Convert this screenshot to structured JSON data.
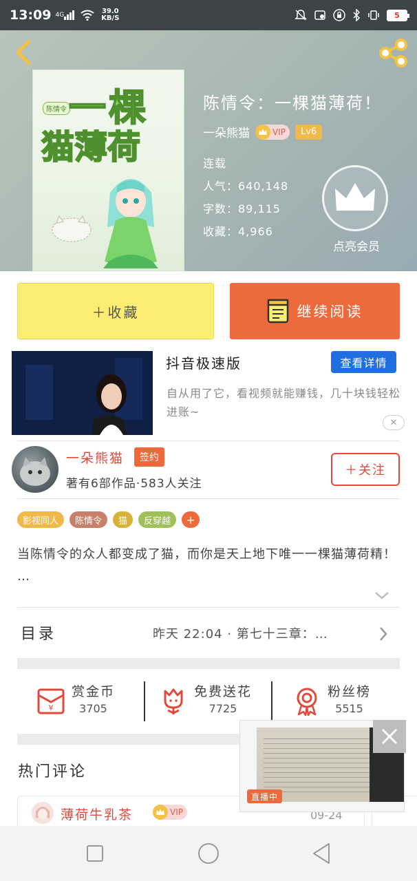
{
  "status_bar": {
    "time": "13:09",
    "network": "4G",
    "speed_value": "39.0",
    "speed_unit": "KB/S",
    "battery": "5"
  },
  "header": {
    "back_icon": "chevron-left-icon",
    "share_icon": "share-icon"
  },
  "book": {
    "cover_title_line1": "一棵",
    "cover_title_line2": "猫薄荷",
    "cover_badge": "陈情令",
    "title": "陈情令：一棵猫薄荷！",
    "author": "一朵熊猫",
    "vip_label": "VIP",
    "level": "Lv6",
    "status": "连载",
    "popularity": "人气：640,148",
    "word_count": "字数：89,115",
    "favorites": "收藏：4,966",
    "member_label": "点亮会员"
  },
  "actions": {
    "favorite_label": "＋收藏",
    "read_label": "继续阅读"
  },
  "ad": {
    "title": "抖音极速版",
    "button": "查看详情",
    "description": "自从用了它，看视频就能赚钱，几十块钱轻松进账~",
    "close": "✕"
  },
  "author_card": {
    "name": "一朵熊猫",
    "sign_badge": "签约",
    "summary": "著有6部作品·583人关注",
    "follow_label": "＋关注"
  },
  "tags": [
    {
      "label": "影视同人",
      "color": "#f1b94a"
    },
    {
      "label": "陈情令",
      "color": "#c98069"
    },
    {
      "label": "猫",
      "color": "#d7b23a"
    },
    {
      "label": "反穿越",
      "color": "#9fc15a"
    }
  ],
  "tag_more": "+",
  "synopsis": "当陈情令的众人都变成了猫，而你是天上地下唯一一棵猫薄荷精！ …",
  "toc": {
    "label": "目录",
    "latest": "昨天 22:04 · 第七十三章：…"
  },
  "rewards": [
    {
      "name": "赏金币",
      "value": "3705",
      "icon": "red-envelope-icon"
    },
    {
      "name": "免费送花",
      "value": "7725",
      "icon": "flower-icon"
    },
    {
      "name": "粉丝榜",
      "value": "5515",
      "icon": "medal-icon"
    }
  ],
  "hot_comments": {
    "title": "热门评论",
    "first": {
      "name": "薄荷牛乳茶",
      "vip": "VIP",
      "time": "09-24"
    }
  },
  "live": {
    "badge": "直播中",
    "close": "✕"
  },
  "colors": {
    "accent_orange": "#ec6a3c",
    "favorite_yellow": "#fbee73",
    "author_red": "#e4483b",
    "ad_blue": "#1f6fe0"
  }
}
